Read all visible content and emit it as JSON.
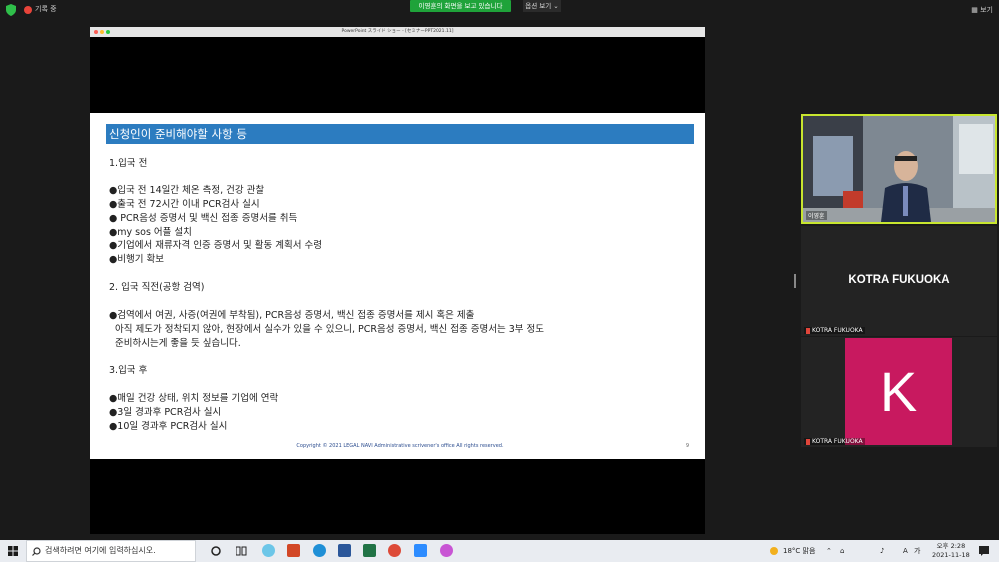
{
  "zoom_bar": {
    "recording_label": "기록 중",
    "viewing_banner": "이영훈의 화면을 보고 있습니다",
    "view_options": "옵션 보기 ⌄",
    "layout_button": "▦ 보기"
  },
  "presentation": {
    "window_title": "PowerPoint スライド ショー - [セミナーPPT2021.11]",
    "header": "신청인이 준비해야할 사항 등",
    "lines": [
      "1.입국 전",
      "●입국 전 14일간 체온 측정, 건강 관찰",
      "●출국 전 72시간 이내 PCR검사 실시",
      "● PCR음성 증명서 및 백신 접종 증명서를 취득",
      "●my sos 어플 설치",
      "●기업에서 재류자격 인증 증명서 및 활동 계획서 수령",
      "●비행기 확보",
      "2. 입국 직전(공항 검역)",
      "●검역에서 여권, 사증(여권에 부착됨), PCR음성 증명서, 백신 접종 증명서를 제시 혹은 제출",
      "  아직 제도가 정착되지 않아, 현장에서 실수가 있을 수 있으니, PCR음성 증명서, 백신 접종 증명서는 3부 정도",
      "  준비하시는게 좋을 듯 싶습니다.",
      "3.입국 후",
      "●매일 건강 상태, 위치 정보를 기업에 연락",
      "●3일 경과후 PCR검사 실시",
      "●10일 경과후 PCR검사 실시"
    ],
    "copyright": "Copyright © 2021 LEGAL NAVI Administrative scrivener's office All rights reserved.",
    "page_number": "9"
  },
  "participants": [
    {
      "name": "이영훈"
    },
    {
      "display": "KOTRA FUKUOKA",
      "name": "KOTRA FUKUOKA"
    },
    {
      "initial": "K",
      "name": "KOTRA FUKUOKA"
    }
  ],
  "taskbar": {
    "search_placeholder": "검색하려면 여기에 입력하십시오.",
    "weather": "18°C 맑음",
    "ime": "A",
    "time": "오후 2:28",
    "date": "2021-11-18"
  },
  "colors": {
    "viewing_banner": "#1fa33a",
    "slide_header": "#2c7cc0",
    "active_speaker_border": "#c8e62f",
    "avatar": "#c8195f"
  }
}
